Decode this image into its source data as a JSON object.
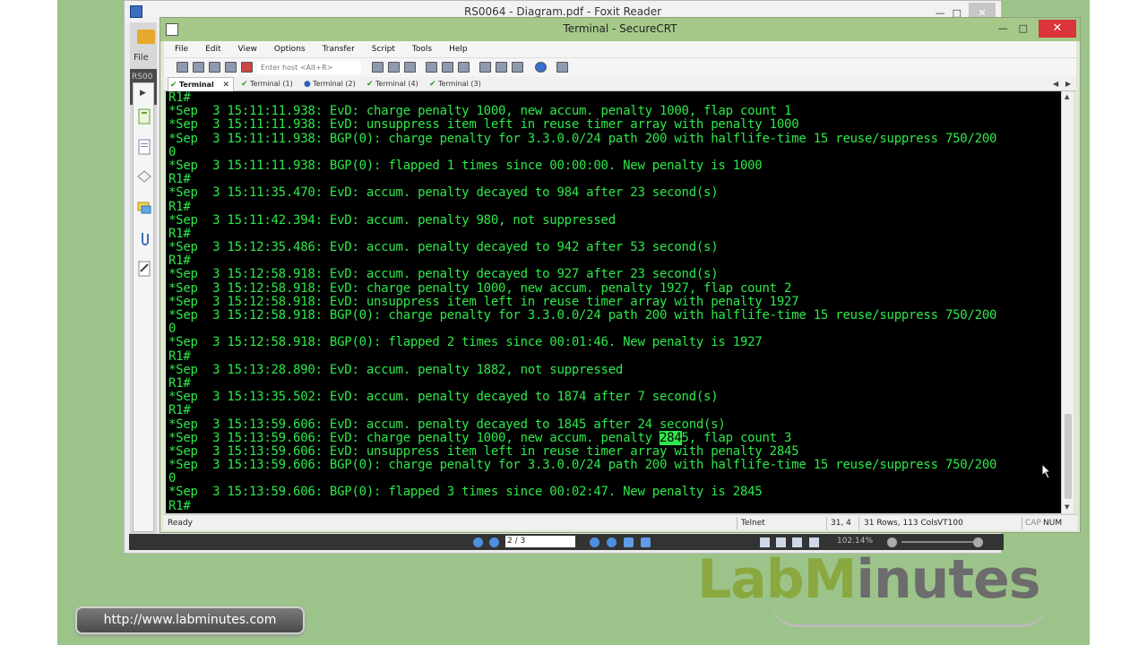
{
  "foxit": {
    "title": "RS0064 - Diagram.pdf - Foxit Reader",
    "file_label": "File",
    "tab_label": "RS00",
    "page_indicator": "2 / 3",
    "zoom": "102.14%"
  },
  "crt": {
    "title": "Terminal - SecureCRT",
    "close_glyph": "✕",
    "menu": [
      "File",
      "Edit",
      "View",
      "Options",
      "Transfer",
      "Script",
      "Tools",
      "Help"
    ],
    "host_placeholder": "Enter host <Alt+R>",
    "tabs": [
      {
        "label": "Terminal",
        "active": true
      },
      {
        "label": "Terminal (1)",
        "active": false
      },
      {
        "label": "Terminal (2)",
        "active": false
      },
      {
        "label": "Terminal (4)",
        "active": false
      },
      {
        "label": "Terminal (3)",
        "active": false
      }
    ],
    "status": {
      "ready": "Ready",
      "protocol": "Telnet",
      "cursor": "31,  4",
      "size": "31 Rows, 113 Cols",
      "emulation": "VT100",
      "cap": "CAP",
      "num": "NUM"
    }
  },
  "terminal_lines": [
    "R1#",
    "*Sep  3 15:11:11.938: EvD: charge penalty 1000, new accum. penalty 1000, flap count 1",
    "*Sep  3 15:11:11.938: EvD: unsuppress item left in reuse timer array with penalty 1000",
    "*Sep  3 15:11:11.938: BGP(0): charge penalty for 3.3.0.0/24 path 200 with halflife-time 15 reuse/suppress 750/200",
    "0",
    "*Sep  3 15:11:11.938: BGP(0): flapped 1 times since 00:00:00. New penalty is 1000",
    "R1#",
    "*Sep  3 15:11:35.470: EvD: accum. penalty decayed to 984 after 23 second(s)",
    "R1#",
    "*Sep  3 15:11:42.394: EvD: accum. penalty 980, not suppressed",
    "R1#",
    "*Sep  3 15:12:35.486: EvD: accum. penalty decayed to 942 after 53 second(s)",
    "R1#",
    "*Sep  3 15:12:58.918: EvD: accum. penalty decayed to 927 after 23 second(s)",
    "*Sep  3 15:12:58.918: EvD: charge penalty 1000, new accum. penalty 1927, flap count 2",
    "*Sep  3 15:12:58.918: EvD: unsuppress item left in reuse timer array with penalty 1927",
    "*Sep  3 15:12:58.918: BGP(0): charge penalty for 3.3.0.0/24 path 200 with halflife-time 15 reuse/suppress 750/200",
    "0",
    "*Sep  3 15:12:58.918: BGP(0): flapped 2 times since 00:01:46. New penalty is 1927",
    "R1#",
    "*Sep  3 15:13:28.890: EvD: accum. penalty 1882, not suppressed",
    "R1#",
    "*Sep  3 15:13:35.502: EvD: accum. penalty decayed to 1874 after 7 second(s)",
    "R1#",
    "*Sep  3 15:13:59.606: EvD: accum. penalty decayed to 1845 after 24 second(s)",
    "*Sep  3 15:13:59.606: EvD: charge penalty 1000, new accum. penalty 2845, flap count 3",
    "*Sep  3 15:13:59.606: EvD: unsuppress item left in reuse timer array with penalty 2845",
    "*Sep  3 15:13:59.606: BGP(0): charge penalty for 3.3.0.0/24 path 200 with halflife-time 15 reuse/suppress 750/200",
    "0",
    "*Sep  3 15:13:59.606: BGP(0): flapped 3 times since 00:02:47. New penalty is 2845",
    "R1#"
  ],
  "highlight": {
    "line": 25,
    "text": "284"
  },
  "branding": {
    "logo_lab": "LabM",
    "logo_rest": "inutes",
    "url": "http://www.labminutes.com"
  },
  "colors": {
    "terminal_fg": "#2ee84a",
    "terminal_bg": "#000000",
    "crt_title_bg": "#a6c98a",
    "backdrop": "#9cc48a"
  }
}
